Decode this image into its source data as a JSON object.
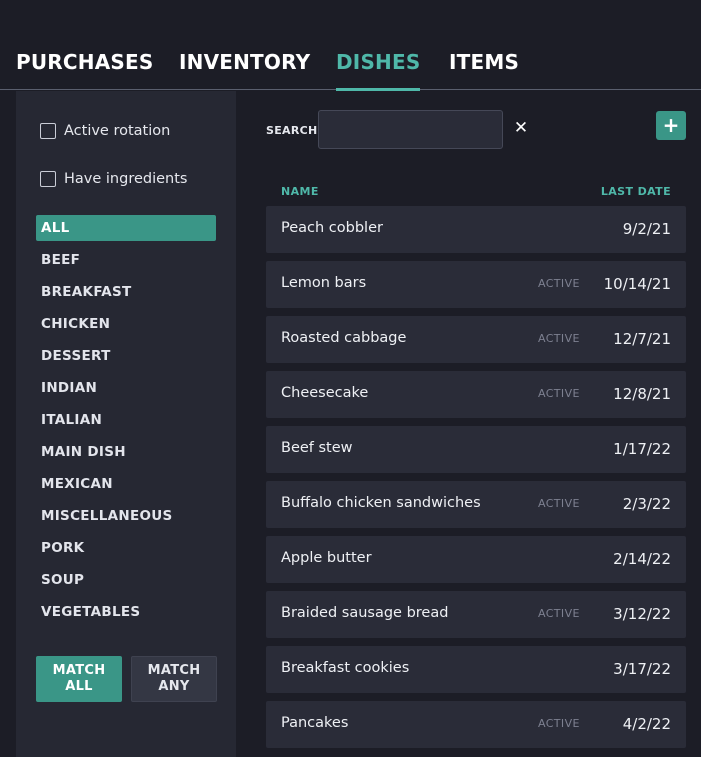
{
  "nav": {
    "tabs": [
      {
        "label": "PURCHASES",
        "active": false
      },
      {
        "label": "INVENTORY",
        "active": false
      },
      {
        "label": "DISHES",
        "active": true
      },
      {
        "label": "ITEMS",
        "active": false
      }
    ]
  },
  "filters": {
    "active_rotation": {
      "label": "Active rotation",
      "checked": false
    },
    "have_ingredients": {
      "label": "Have ingredients",
      "checked": false
    }
  },
  "categories": {
    "selected": "ALL",
    "items": [
      "ALL",
      "BEEF",
      "BREAKFAST",
      "CHICKEN",
      "DESSERT",
      "INDIAN",
      "ITALIAN",
      "MAIN DISH",
      "MEXICAN",
      "MISCELLANEOUS",
      "PORK",
      "SOUP",
      "VEGETABLES"
    ]
  },
  "match": {
    "all": {
      "line1": "MATCH",
      "line2": "ALL"
    },
    "any": {
      "line1": "MATCH",
      "line2": "ANY"
    },
    "selected": "all"
  },
  "search": {
    "label": "SEARCH",
    "value": "",
    "clear_symbol": "✕"
  },
  "add_button": {
    "symbol": "+"
  },
  "table": {
    "headers": {
      "name": "NAME",
      "date": "LAST DATE"
    },
    "rows": [
      {
        "name": "Peach cobbler",
        "badge": "",
        "date": "9/2/21"
      },
      {
        "name": "Lemon bars",
        "badge": "ACTIVE",
        "date": "10/14/21"
      },
      {
        "name": "Roasted cabbage",
        "badge": "ACTIVE",
        "date": "12/7/21"
      },
      {
        "name": "Cheesecake",
        "badge": "ACTIVE",
        "date": "12/8/21"
      },
      {
        "name": "Beef stew",
        "badge": "",
        "date": "1/17/22"
      },
      {
        "name": "Buffalo chicken sandwiches",
        "badge": "ACTIVE",
        "date": "2/3/22"
      },
      {
        "name": "Apple butter",
        "badge": "",
        "date": "2/14/22"
      },
      {
        "name": "Braided sausage bread",
        "badge": "ACTIVE",
        "date": "3/12/22"
      },
      {
        "name": "Breakfast cookies",
        "badge": "",
        "date": "3/17/22"
      },
      {
        "name": "Pancakes",
        "badge": "ACTIVE",
        "date": "4/2/22"
      }
    ]
  },
  "colors": {
    "accent": "#4fb8a9",
    "accent_fill": "#3a9687",
    "background": "#1c1d26",
    "panel": "#262833",
    "row": "#2a2c38"
  }
}
